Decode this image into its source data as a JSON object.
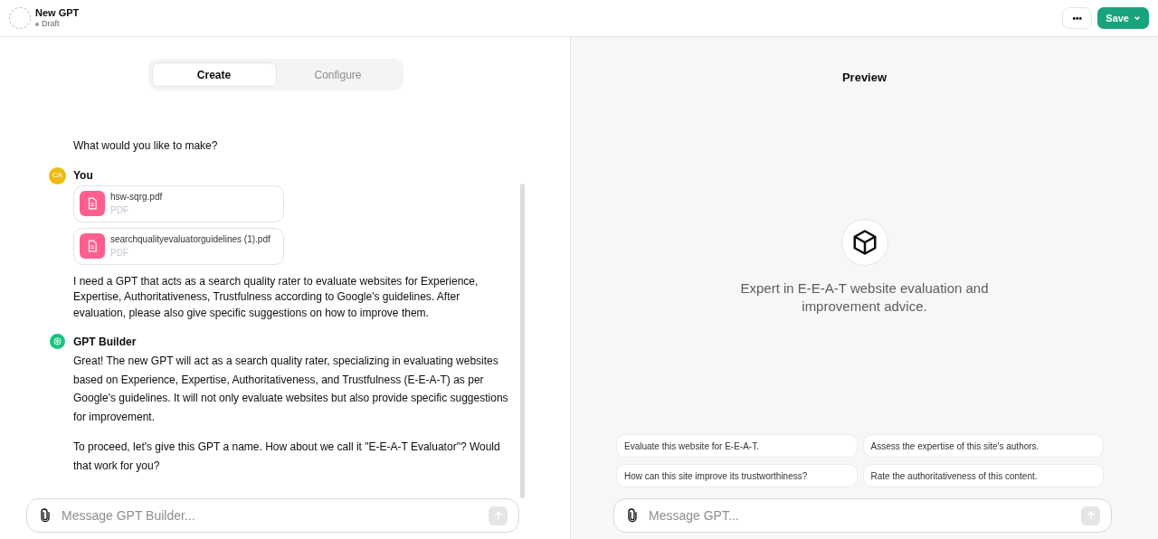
{
  "header": {
    "title": "New GPT",
    "status": "Draft",
    "more_label": "•••",
    "save_label": "Save"
  },
  "tabs": [
    {
      "label": "Create",
      "selected": true
    },
    {
      "label": "Configure",
      "selected": false
    }
  ],
  "messages": [
    {
      "kind": "plain",
      "paragraphs": [
        "What would you like to make?"
      ]
    },
    {
      "kind": "user",
      "author": "You",
      "initials": "CA",
      "files": [
        {
          "name": "hsw-sqrg.pdf",
          "type": "PDF"
        },
        {
          "name": "searchqualityevaluatorguidelines (1).pdf",
          "type": "PDF"
        }
      ],
      "paragraphs": [
        "I need a GPT that acts as a search quality rater to evaluate websites for Experience, Expertise, Authoritativeness, Trustfulness according to Google's guidelines. After evaluation, please also give specific suggestions on how to improve them."
      ]
    },
    {
      "kind": "builder",
      "author": "GPT Builder",
      "paragraphs": [
        "Great! The new GPT will act as a search quality rater, specializing in evaluating websites based on Experience, Expertise, Authoritativeness, and Trustfulness (E-E-A-T) as per Google's guidelines. It will not only evaluate websites but also provide specific suggestions for improvement.",
        "To proceed, let's give this GPT a name. How about we call it \"E-E-A-T Evaluator\"? Would that work for you?"
      ]
    }
  ],
  "builder_input": {
    "placeholder": "Message GPT Builder..."
  },
  "preview": {
    "title": "Preview",
    "description": "Expert in E-E-A-T website evaluation and improvement advice.",
    "suggestions": [
      "Evaluate this website for E-E-A-T.",
      "Assess the expertise of this site's authors.",
      "How can this site improve its trustworthiness?",
      "Rate the authoritativeness of this content."
    ],
    "input": {
      "placeholder": "Message GPT..."
    }
  }
}
